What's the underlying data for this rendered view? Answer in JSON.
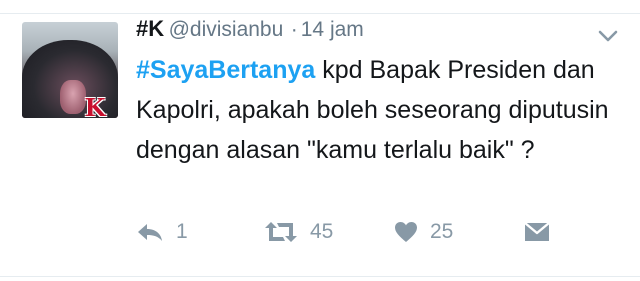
{
  "tweet": {
    "author": {
      "name": "#K",
      "handle": "@divisianbu",
      "separator": "·",
      "timestamp": "14 jam",
      "avatar_badge": "K"
    },
    "body": {
      "hashtag": "#SayaBertanya",
      "text": " kpd Bapak Presiden dan Kapolri, apakah boleh seseorang diputusin dengan alasan \"kamu terlalu baik\" ?"
    },
    "actions": {
      "reply_count": "1",
      "retweet_count": "45",
      "like_count": "25"
    }
  },
  "colors": {
    "hashtag": "#1da1f2",
    "text": "#14171a",
    "muted": "#657786",
    "icon": "#8899a6"
  }
}
